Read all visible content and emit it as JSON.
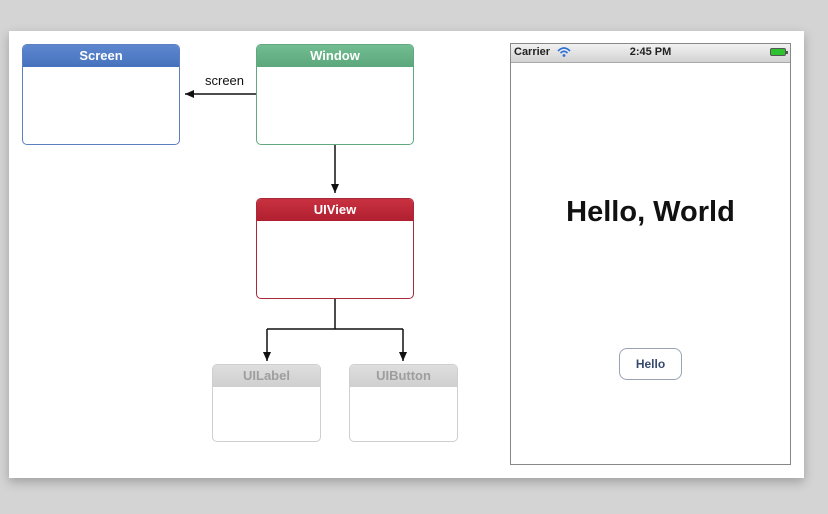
{
  "diagram": {
    "nodes": {
      "screen": "Screen",
      "window": "Window",
      "uiview": "UIView",
      "uilabel": "UILabel",
      "uibutton": "UIButton"
    },
    "edge_label": "screen"
  },
  "device": {
    "status_bar": {
      "carrier": "Carrier",
      "time": "2:45 PM"
    },
    "label_text": "Hello, World",
    "button_label": "Hello"
  },
  "colors": {
    "screen_header": "#4f7bc6",
    "window_header": "#66b086",
    "uiview_header": "#bf2836",
    "faded_header": "#d6d6d6",
    "battery": "#2fc22f"
  },
  "icons": [
    "wifi-icon",
    "battery-icon"
  ]
}
